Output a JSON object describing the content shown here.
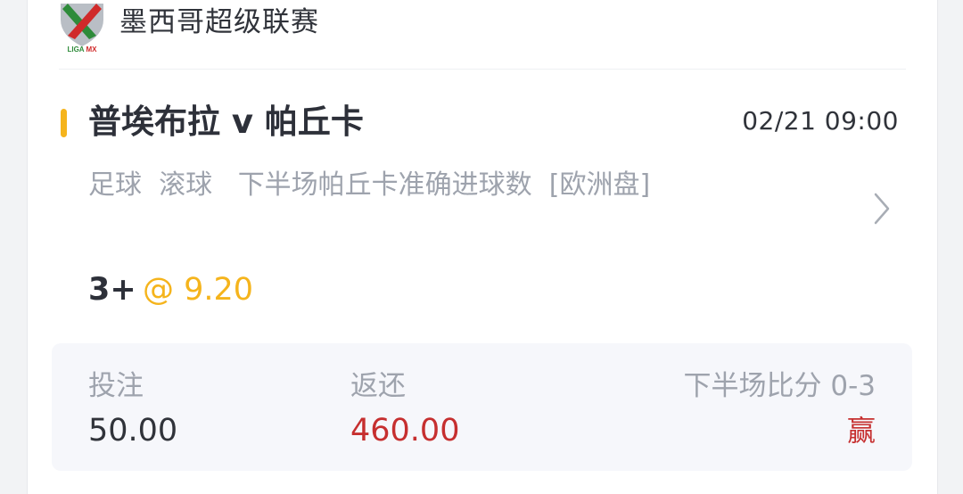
{
  "league": {
    "name": "墨西哥超级联赛",
    "logo_text": "LIGA MX",
    "logo_icon": "liga-mx-logo",
    "colors": {
      "green": "#2e8b3a",
      "red": "#d02a2a",
      "grey": "#9aa0a6"
    }
  },
  "match": {
    "title": "普埃布拉 v 帕丘卡",
    "time": "02/21 09:00",
    "sport": "足球",
    "bet_type": "滚球",
    "market": "下半场帕丘卡准确进球数",
    "odds_format": "[欧洲盘]",
    "selection": "3+",
    "odds": "@ 9.20"
  },
  "summary": {
    "stake_label": "投注",
    "stake_value": "50.00",
    "return_label": "返还",
    "return_value": "460.00",
    "score_label": "下半场比分 0-3",
    "result": "赢"
  },
  "colors": {
    "accent": "#f5b41c",
    "win_red": "#c62f2f",
    "text_dark": "#2d3039",
    "text_muted": "#9ea3ad"
  }
}
